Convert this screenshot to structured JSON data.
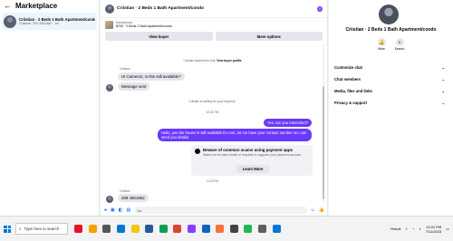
{
  "left": {
    "title": "Marketplace",
    "conversation": {
      "name": "Criistian · 2 Beds 1 Bath Apartment/condo",
      "sub": "Criistian: 209 4551962 · 1m"
    }
  },
  "chat": {
    "title": "Criistian · 2 Beds 1 Bath Apartment/condo",
    "listing_label": "Marketplace",
    "listing_price": "$700 · 2 Beds 1 Bath Apartment/condo",
    "buttons": [
      "View buyer",
      "More options"
    ],
    "messages": {
      "started": "Criistian started this chat.",
      "view_profile": "View buyer profile",
      "sender1": "Criistian",
      "msg1": "Hi Cameron, is this still available?",
      "msg2": "Message sent",
      "waiting": "Criistian is waiting for your response.",
      "time1": "10:31 PM",
      "out1": "Yes, are you interested?",
      "out2": "Hello, yes the house is still available for rent, let me have your contact number so i can send you details",
      "card_title": "Beware of common scams using payment apps",
      "card_body": "Watch out for fake emails or requests to upgrade your payment account.",
      "card_button": "Learn More",
      "time2": "11:03 PM",
      "sender2": "Criistian",
      "msg3": "209 4551962"
    },
    "composer_placeholder": "Aa"
  },
  "right": {
    "name": "Criistian · 2 Beds 1 Bath Apartment/condo",
    "actions": [
      "Mute",
      "Search"
    ],
    "menu": [
      "Customize chat",
      "Chat members",
      "Media, files and links",
      "Privacy & support"
    ]
  },
  "taskbar": {
    "search_placeholder": "Type here to search",
    "tray_label": "Result",
    "time": "11:01 PM",
    "date": "7/11/2023"
  },
  "colors": {
    "accent": "#6a38ff",
    "bubble_in": "#e4e6eb",
    "link": "#0866ff"
  }
}
